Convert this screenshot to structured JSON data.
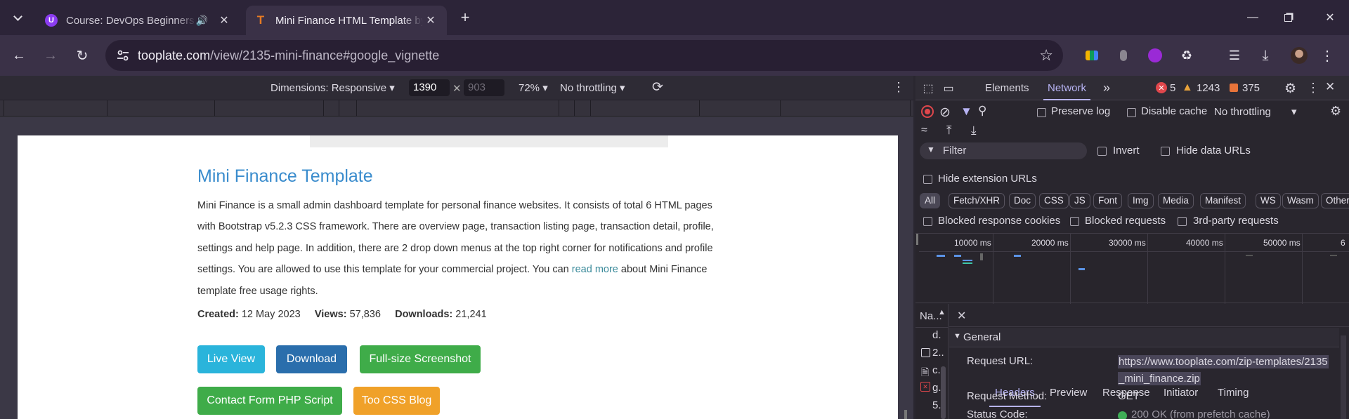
{
  "browser": {
    "tabs": [
      {
        "title": "Course: DevOps Beginners to",
        "favicon_color": "#8b3cf0",
        "favicon_text": "U",
        "active": false
      },
      {
        "title": "Mini Finance HTML Template by",
        "favicon_color": "#e87b23",
        "favicon_text": "T",
        "active": true
      }
    ],
    "url_host": "tooplate.com",
    "url_path": "/view/2135-mini-finance#google_vignette"
  },
  "device_toolbar": {
    "dimensions_label": "Dimensions: Responsive",
    "width": "1390",
    "height": "903",
    "zoom": "72%",
    "throttle": "No throttling"
  },
  "page": {
    "title": "Mini Finance Template",
    "desc_before_link": "Mini Finance is a small admin dashboard template for personal finance websites. It consists of total 6 HTML pages with Bootstrap v5.2.3 CSS framework. There are overview page, transaction listing page, transaction detail, profile, settings and help page. In addition, there are 2 drop down menus at the top right corner for notifications and profile settings. You are allowed to use this template for your commercial project. You can ",
    "desc_link": "read more",
    "desc_after_link": " about Mini Finance template free usage rights.",
    "created_label": "Created:",
    "created_value": "12 May 2023",
    "views_label": "Views:",
    "views_value": "57,836",
    "downloads_label": "Downloads:",
    "downloads_value": "21,241",
    "buttons": {
      "live_view": "Live View",
      "download": "Download",
      "screenshot": "Full-size Screenshot",
      "contact_form": "Contact Form PHP Script",
      "blog": "Too CSS Blog"
    }
  },
  "devtools": {
    "tabs": {
      "elements": "Elements",
      "network": "Network"
    },
    "counts": {
      "errors": "5",
      "warnings": "1243",
      "issues": "375"
    },
    "toolbar": {
      "preserve_log": "Preserve log",
      "disable_cache": "Disable cache",
      "throttle": "No throttling"
    },
    "filter_placeholder": "Filter",
    "invert": "Invert",
    "hide_data_urls": "Hide data URLs",
    "hide_extension_urls": "Hide extension URLs",
    "type_filters": [
      "All",
      "Fetch/XHR",
      "Doc",
      "CSS",
      "JS",
      "Font",
      "Img",
      "Media",
      "Manifest",
      "WS",
      "Wasm",
      "Other"
    ],
    "blocked_response_cookies": "Blocked response cookies",
    "blocked_requests": "Blocked requests",
    "third_party_requests": "3rd-party requests",
    "timeline_labels": [
      "10000 ms",
      "20000 ms",
      "30000 ms",
      "40000 ms",
      "50000 ms",
      "6"
    ],
    "name_header": "Na...",
    "name_rows": [
      "d.",
      "2..",
      "c...",
      "g.",
      "5.."
    ],
    "detail_tabs": {
      "headers": "Headers",
      "preview": "Preview",
      "response": "Response",
      "initiator": "Initiator",
      "timing": "Timing"
    },
    "general_label": "General",
    "request_url_label": "Request URL:",
    "request_url_value_line1": "https://www.tooplate.com/zip-templates/2135",
    "request_url_value_line2": "_mini_finance.zip",
    "request_method_label": "Request Method:",
    "request_method_value": "GET",
    "status_code_label": "Status Code:",
    "status_code_value": "200 OK (from prefetch cache)"
  }
}
